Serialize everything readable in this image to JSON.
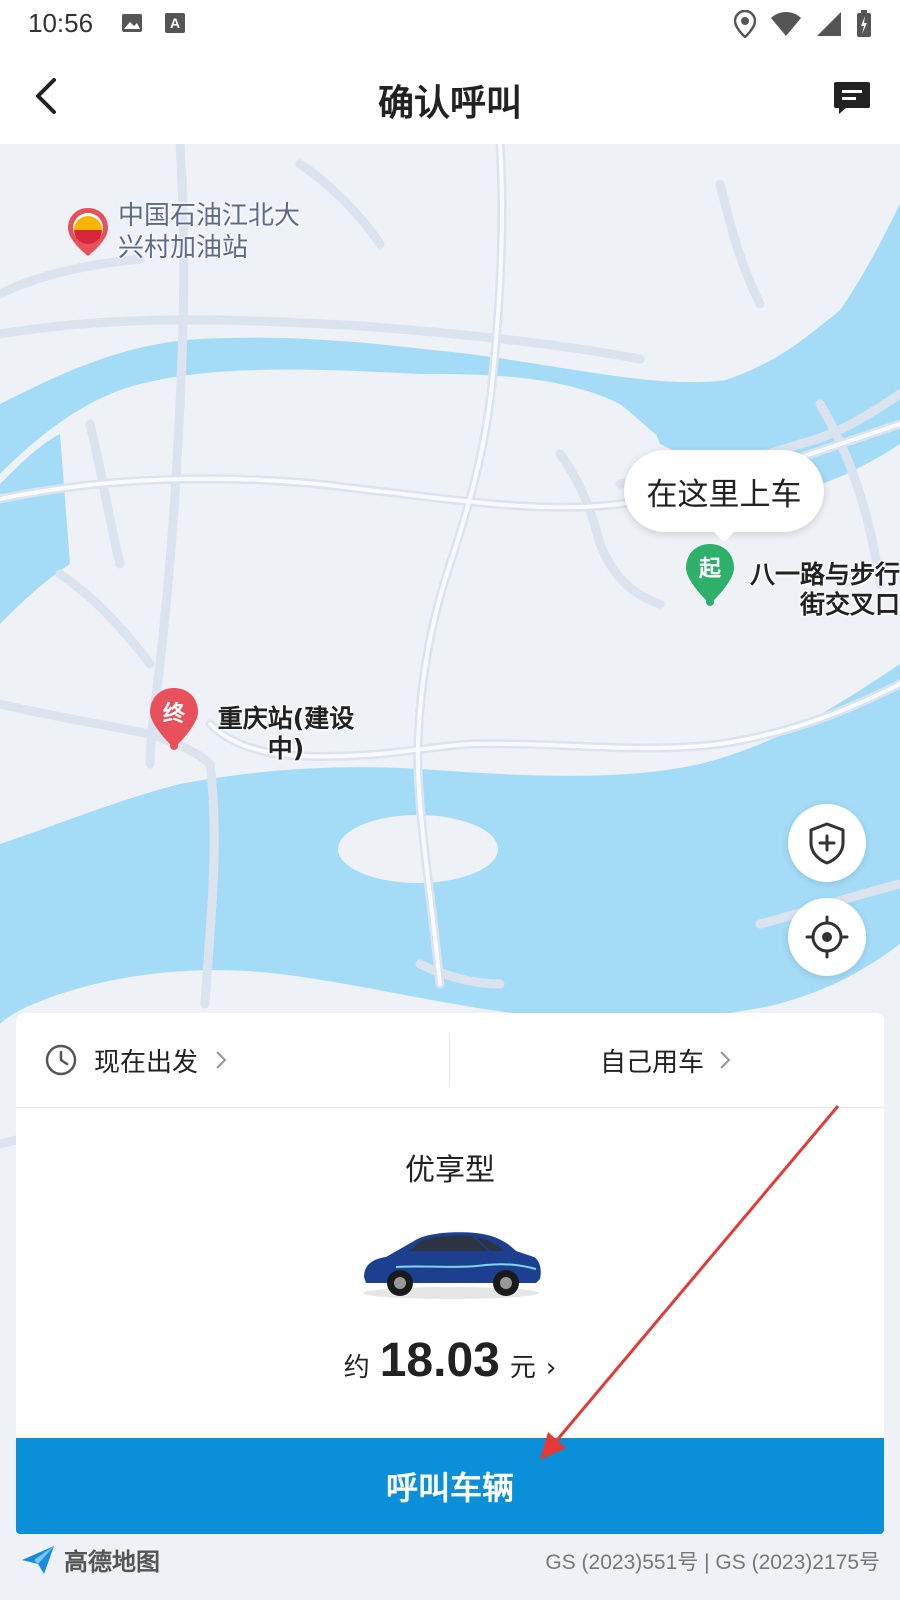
{
  "status_bar": {
    "time": "10:56",
    "left_icons": [
      "image-icon",
      "text-a-icon"
    ],
    "right_icons": [
      "location-icon",
      "wifi-icon",
      "signal-icon",
      "battery-icon"
    ]
  },
  "header": {
    "title": "确认呼叫",
    "back_icon": "back-chevron-icon",
    "message_icon": "message-icon"
  },
  "map": {
    "poi_gas_station": "中国石油江北大兴村加油站",
    "pickup_bubble": "在这里上车",
    "start_badge": "起",
    "start_place": "八一路与步行街交叉口",
    "end_badge": "终",
    "end_place": "重庆站(建设中)",
    "safety_icon": "shield-plus-icon",
    "locate_icon": "locate-target-icon"
  },
  "card": {
    "depart_label": "现在出发",
    "rider_label": "自己用车",
    "car_type": "优享型",
    "price_prefix": "约",
    "price_value": "18.03",
    "price_unit": "元",
    "price_chevron": "›"
  },
  "call_button": "呼叫车辆",
  "footer": {
    "logo_text": "高德地图",
    "license": "GS (2023)551号 | GS (2023)2175号"
  },
  "colors": {
    "accent": "#0a8fd8",
    "water": "#a4dcf8",
    "start_pin": "#2db06a",
    "end_pin": "#e8505b",
    "annotation": "#e53935"
  }
}
